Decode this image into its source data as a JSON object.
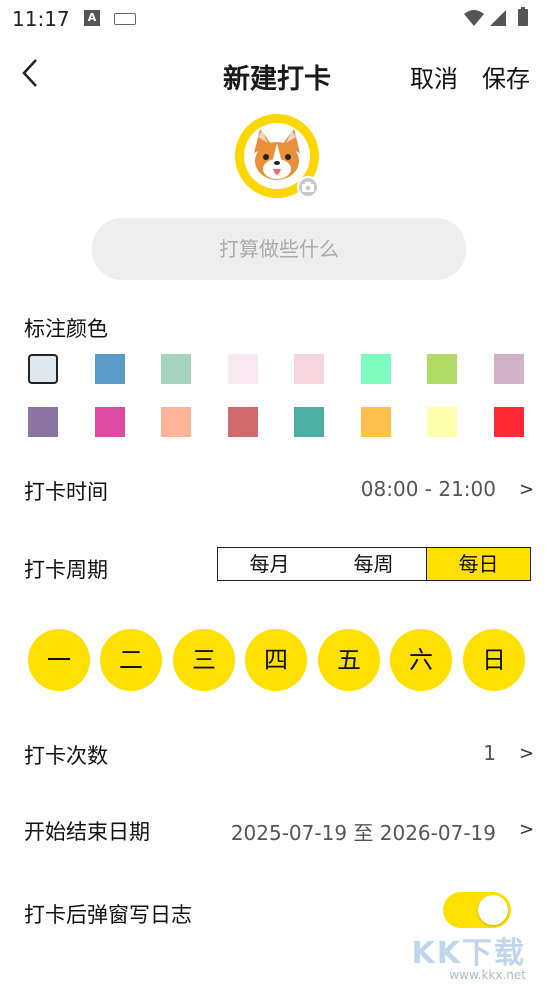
{
  "status_bar": {
    "time": "11:17",
    "ime_badge": "A"
  },
  "header": {
    "title": "新建打卡",
    "cancel_label": "取消",
    "save_label": "保存"
  },
  "plan": {
    "placeholder": "打算做些什么"
  },
  "color_section": {
    "label": "标注颜色",
    "colors": [
      "#DDE8F0",
      "#5B9BC8",
      "#A6D3BC",
      "#F7E9EF",
      "#F8D6DF",
      "#7EFBBE",
      "#B0DC66",
      "#D1B1C8",
      "#8A74A4",
      "#DE4BA4",
      "#FFB497",
      "#D06A6C",
      "#4FAEA2",
      "#FFC04E",
      "#FFFFAC",
      "#FF2B34"
    ],
    "selected_index": 0
  },
  "time_row": {
    "label": "打卡时间",
    "value": "08:00 - 21:00",
    "chevron": ">"
  },
  "cycle_row": {
    "label": "打卡周期",
    "options": [
      "每月",
      "每周",
      "每日"
    ],
    "selected": "每日"
  },
  "weekdays": [
    "一",
    "二",
    "三",
    "四",
    "五",
    "六",
    "日"
  ],
  "count_row": {
    "label": "打卡次数",
    "value": "1",
    "chevron": ">"
  },
  "date_row": {
    "label": "开始结束日期",
    "value": "2025-07-19 至 2026-07-19",
    "chevron": ">"
  },
  "journal_row": {
    "label": "打卡后弹窗写日志",
    "toggle_on": true
  },
  "watermark": {
    "text": "KK下载",
    "url": "www.kkx.net"
  }
}
